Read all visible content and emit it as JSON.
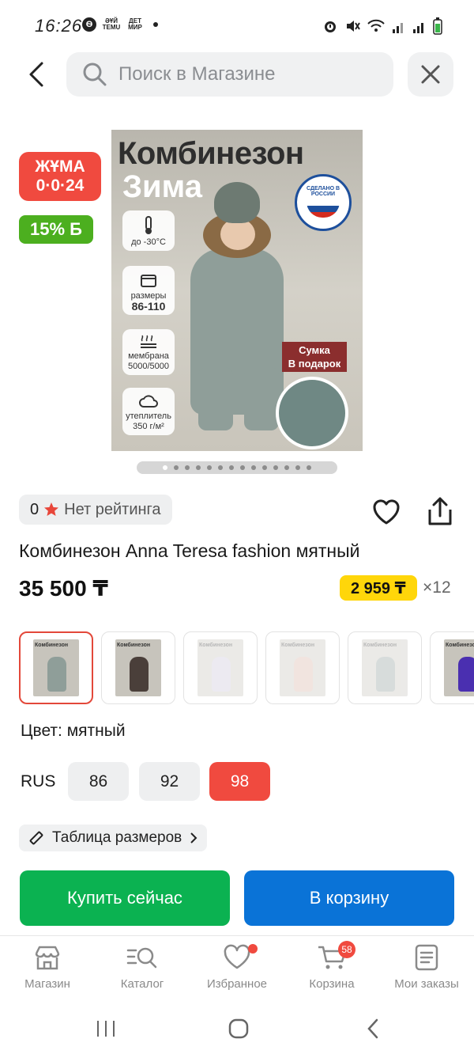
{
  "status_bar": {
    "time": "16:26",
    "app_icons": [
      "Ѳ",
      "ƏҰЙ TEMU",
      "ДЕТ МИР"
    ]
  },
  "search": {
    "placeholder": "Поиск в Магазине",
    "back_icon": "chevron-left-icon",
    "clear_icon": "close-icon"
  },
  "badges": {
    "friday": [
      "ЖҰМА",
      "0·0·24"
    ],
    "discount": "15% Б"
  },
  "product_image": {
    "title_line1": "Комбинезон",
    "title_line2": "Зима",
    "features": [
      {
        "icon": "thermometer-icon",
        "text": "до -30°С",
        "bold": ""
      },
      {
        "icon": "box-icon",
        "text": "размеры",
        "bold": "86-110"
      },
      {
        "icon": "membrane-icon",
        "text": "мембрана 5000/5000",
        "bold": ""
      },
      {
        "icon": "cloud-icon",
        "text": "утеплитель 350 г/м²",
        "bold": ""
      }
    ],
    "seal_text": "СДЕЛАНО В РОССИИ",
    "gift_text_line1": "Сумка",
    "gift_text_line2": "В подарок"
  },
  "gallery": {
    "dots_total": 14,
    "active_index": 0
  },
  "rating": {
    "count": "0",
    "text": "Нет рейтинга",
    "star_color": "#e8463a"
  },
  "product": {
    "title": "Комбинезон Anna Teresa fashion мятный",
    "price": "35 500 ₸",
    "installment_price": "2 959 ₸",
    "installment_months": "×12"
  },
  "thumbnails": [
    {
      "label": "Комбинезон",
      "color": "#8f9e99",
      "selected": true,
      "faded": false
    },
    {
      "label": "Комбинезон",
      "color": "#4a3f3a",
      "selected": false,
      "faded": false
    },
    {
      "label": "Комбинезон",
      "color": "#c9c4d8",
      "selected": false,
      "faded": true
    },
    {
      "label": "Комбинезон",
      "color": "#d9b3a5",
      "selected": false,
      "faded": true
    },
    {
      "label": "Комбинезон",
      "color": "#8f9e99",
      "selected": false,
      "faded": true
    },
    {
      "label": "Комбинезон",
      "color": "#4a2fb0",
      "selected": false,
      "faded": false
    }
  ],
  "color": {
    "label": "Цвет: мятный"
  },
  "sizes": {
    "prefix": "RUS",
    "options": [
      "86",
      "92",
      "98"
    ],
    "selected": "98"
  },
  "size_table": {
    "label": "Таблица размеров"
  },
  "actions": {
    "buy_now": "Купить сейчас",
    "add_to_cart": "В корзину"
  },
  "bottom_nav": [
    {
      "label": "Магазин",
      "icon": "store-icon"
    },
    {
      "label": "Каталог",
      "icon": "catalog-search-icon"
    },
    {
      "label": "Избранное",
      "icon": "heart-icon"
    },
    {
      "label": "Корзина",
      "icon": "cart-icon",
      "badge": "58"
    },
    {
      "label": "Мои заказы",
      "icon": "orders-icon"
    }
  ],
  "colors": {
    "accent_red": "#f04a3f",
    "green": "#0bb251",
    "blue": "#0a73d7",
    "yellow": "#ffd60a"
  }
}
